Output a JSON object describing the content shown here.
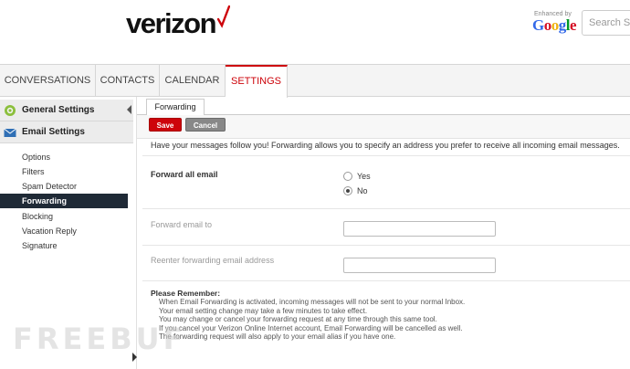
{
  "header": {
    "logo": "verizon",
    "enhanced_by": "Enhanced by",
    "google": [
      "G",
      "o",
      "o",
      "g",
      "l",
      "e"
    ],
    "search_placeholder": "Search Site"
  },
  "tabs": [
    {
      "label": "CONVERSATIONS",
      "active": false
    },
    {
      "label": "CONTACTS",
      "active": false
    },
    {
      "label": "CALENDAR",
      "active": false
    },
    {
      "label": "SETTINGS",
      "active": true
    }
  ],
  "sidebar": {
    "general_settings": "General Settings",
    "email_settings": "Email Settings",
    "items": [
      {
        "label": "Options"
      },
      {
        "label": "Filters"
      },
      {
        "label": "Spam Detector"
      },
      {
        "label": "Forwarding",
        "active": true
      },
      {
        "label": "Blocking"
      },
      {
        "label": "Vacation Reply"
      },
      {
        "label": "Signature"
      }
    ]
  },
  "main": {
    "sub_tab": "Forwarding",
    "save_label": "Save",
    "cancel_label": "Cancel",
    "intro": "Have your messages follow you! Forwarding allows you to specify an address you prefer to receive all incoming email messages.",
    "forward_all_label": "Forward all email",
    "option_yes": "Yes",
    "option_no": "No",
    "selected_option": "No",
    "forward_to_label": "Forward email to",
    "forward_to_value": "",
    "reenter_label": "Reenter forwarding email address",
    "reenter_value": "",
    "remember_title": "Please Remember:",
    "remember_lines": [
      "When Email Forwarding is activated, incoming messages will not be sent to your normal Inbox.",
      "Your email setting change may take a few minutes to take effect.",
      "You may change or cancel your forwarding request at any time through this same tool.",
      "If you cancel your Verizon Online Internet account, Email Forwarding will be cancelled as well.",
      "The forwarding request will also apply to your email alias if you have one."
    ]
  },
  "watermark": "FREEBUF",
  "colors": {
    "brand_red": "#cd040b",
    "sidebar_active": "#1f2a36",
    "google_blue": "#3369e8",
    "google_red": "#d50f25",
    "google_yellow": "#eeb211",
    "google_green": "#009925"
  }
}
